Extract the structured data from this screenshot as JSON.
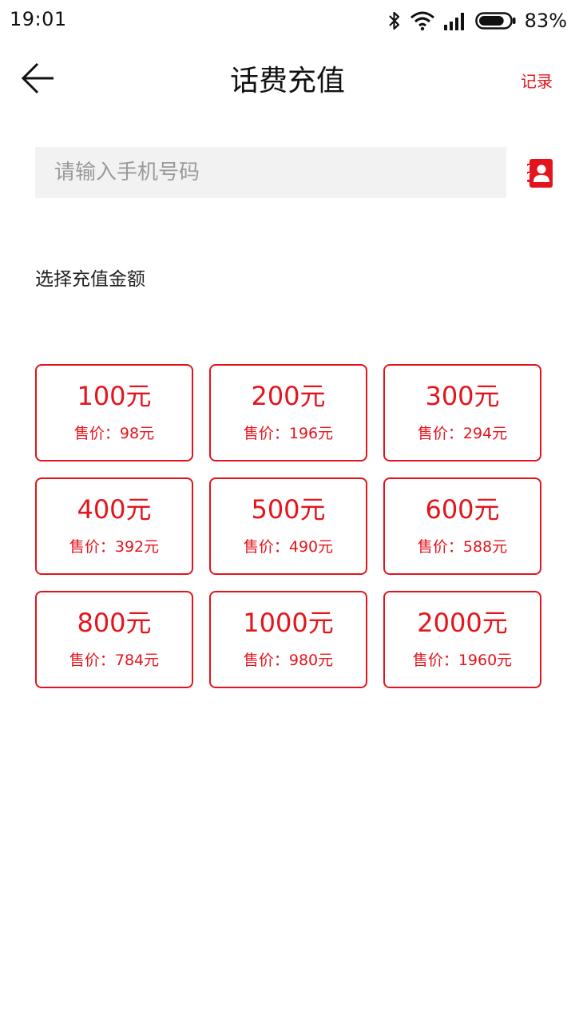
{
  "status_bar": {
    "time": "19:01",
    "battery_percent": "83%",
    "battery_level": 0.83,
    "icons": [
      "bluetooth-icon",
      "wifi-icon",
      "signal-icon",
      "battery-icon"
    ]
  },
  "header": {
    "title": "话费充值",
    "record_label": "记录",
    "back_icon": "back-arrow-icon"
  },
  "phone_input": {
    "placeholder": "请输入手机号码",
    "value": "",
    "contacts_icon": "contacts-book-icon"
  },
  "section": {
    "label": "选择充值金额"
  },
  "amounts": [
    {
      "value": "100元",
      "price": "售价：98元"
    },
    {
      "value": "200元",
      "price": "售价：196元"
    },
    {
      "value": "300元",
      "price": "售价：294元"
    },
    {
      "value": "400元",
      "price": "售价：392元"
    },
    {
      "value": "500元",
      "price": "售价：490元"
    },
    {
      "value": "600元",
      "price": "售价：588元"
    },
    {
      "value": "800元",
      "price": "售价：784元"
    },
    {
      "value": "1000元",
      "price": "售价：980元"
    },
    {
      "value": "2000元",
      "price": "售价：1960元"
    }
  ],
  "colors": {
    "accent": "#e4141c",
    "input_bg": "#f2f2f2",
    "text": "#111111"
  }
}
